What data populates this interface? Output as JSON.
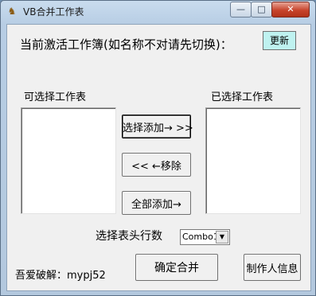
{
  "window": {
    "title": "VB合并工作表",
    "minimize_glyph": "—",
    "maximize_glyph": "□",
    "close_glyph": "✕",
    "app_icon": "vb-app-icon"
  },
  "header": {
    "active_workbook_label": "当前激活工作簿(如名称不对请先切换)：",
    "refresh_button": "更新"
  },
  "lists": {
    "available_label": "可选择工作表",
    "selected_label": "已选择工作表"
  },
  "actions": {
    "add_selected": "选择添加→ >>",
    "remove": "<< ←移除",
    "add_all": "全部添加→"
  },
  "header_rows": {
    "label": "选择表头行数",
    "combo_value": "Combo1"
  },
  "footer": {
    "credit": "吾爱破解：mypj52",
    "confirm_button": "确定合并",
    "author_button": "制作人信息"
  },
  "colors": {
    "refresh_button_bg": "#bff2f0",
    "window_frame": "#b7cde4",
    "close_button": "#c7442c"
  }
}
